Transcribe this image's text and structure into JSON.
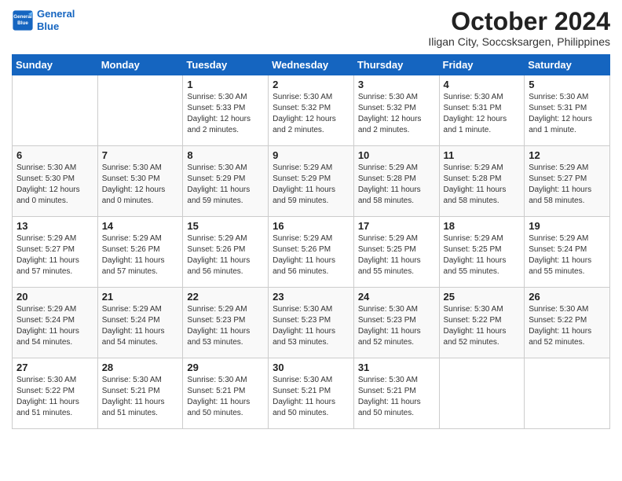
{
  "header": {
    "logo_line1": "General",
    "logo_line2": "Blue",
    "month": "October 2024",
    "location": "Iligan City, Soccsksargen, Philippines"
  },
  "weekdays": [
    "Sunday",
    "Monday",
    "Tuesday",
    "Wednesday",
    "Thursday",
    "Friday",
    "Saturday"
  ],
  "weeks": [
    [
      {
        "day": "",
        "detail": ""
      },
      {
        "day": "",
        "detail": ""
      },
      {
        "day": "1",
        "detail": "Sunrise: 5:30 AM\nSunset: 5:33 PM\nDaylight: 12 hours\nand 2 minutes."
      },
      {
        "day": "2",
        "detail": "Sunrise: 5:30 AM\nSunset: 5:32 PM\nDaylight: 12 hours\nand 2 minutes."
      },
      {
        "day": "3",
        "detail": "Sunrise: 5:30 AM\nSunset: 5:32 PM\nDaylight: 12 hours\nand 2 minutes."
      },
      {
        "day": "4",
        "detail": "Sunrise: 5:30 AM\nSunset: 5:31 PM\nDaylight: 12 hours\nand 1 minute."
      },
      {
        "day": "5",
        "detail": "Sunrise: 5:30 AM\nSunset: 5:31 PM\nDaylight: 12 hours\nand 1 minute."
      }
    ],
    [
      {
        "day": "6",
        "detail": "Sunrise: 5:30 AM\nSunset: 5:30 PM\nDaylight: 12 hours\nand 0 minutes."
      },
      {
        "day": "7",
        "detail": "Sunrise: 5:30 AM\nSunset: 5:30 PM\nDaylight: 12 hours\nand 0 minutes."
      },
      {
        "day": "8",
        "detail": "Sunrise: 5:30 AM\nSunset: 5:29 PM\nDaylight: 11 hours\nand 59 minutes."
      },
      {
        "day": "9",
        "detail": "Sunrise: 5:29 AM\nSunset: 5:29 PM\nDaylight: 11 hours\nand 59 minutes."
      },
      {
        "day": "10",
        "detail": "Sunrise: 5:29 AM\nSunset: 5:28 PM\nDaylight: 11 hours\nand 58 minutes."
      },
      {
        "day": "11",
        "detail": "Sunrise: 5:29 AM\nSunset: 5:28 PM\nDaylight: 11 hours\nand 58 minutes."
      },
      {
        "day": "12",
        "detail": "Sunrise: 5:29 AM\nSunset: 5:27 PM\nDaylight: 11 hours\nand 58 minutes."
      }
    ],
    [
      {
        "day": "13",
        "detail": "Sunrise: 5:29 AM\nSunset: 5:27 PM\nDaylight: 11 hours\nand 57 minutes."
      },
      {
        "day": "14",
        "detail": "Sunrise: 5:29 AM\nSunset: 5:26 PM\nDaylight: 11 hours\nand 57 minutes."
      },
      {
        "day": "15",
        "detail": "Sunrise: 5:29 AM\nSunset: 5:26 PM\nDaylight: 11 hours\nand 56 minutes."
      },
      {
        "day": "16",
        "detail": "Sunrise: 5:29 AM\nSunset: 5:26 PM\nDaylight: 11 hours\nand 56 minutes."
      },
      {
        "day": "17",
        "detail": "Sunrise: 5:29 AM\nSunset: 5:25 PM\nDaylight: 11 hours\nand 55 minutes."
      },
      {
        "day": "18",
        "detail": "Sunrise: 5:29 AM\nSunset: 5:25 PM\nDaylight: 11 hours\nand 55 minutes."
      },
      {
        "day": "19",
        "detail": "Sunrise: 5:29 AM\nSunset: 5:24 PM\nDaylight: 11 hours\nand 55 minutes."
      }
    ],
    [
      {
        "day": "20",
        "detail": "Sunrise: 5:29 AM\nSunset: 5:24 PM\nDaylight: 11 hours\nand 54 minutes."
      },
      {
        "day": "21",
        "detail": "Sunrise: 5:29 AM\nSunset: 5:24 PM\nDaylight: 11 hours\nand 54 minutes."
      },
      {
        "day": "22",
        "detail": "Sunrise: 5:29 AM\nSunset: 5:23 PM\nDaylight: 11 hours\nand 53 minutes."
      },
      {
        "day": "23",
        "detail": "Sunrise: 5:30 AM\nSunset: 5:23 PM\nDaylight: 11 hours\nand 53 minutes."
      },
      {
        "day": "24",
        "detail": "Sunrise: 5:30 AM\nSunset: 5:23 PM\nDaylight: 11 hours\nand 52 minutes."
      },
      {
        "day": "25",
        "detail": "Sunrise: 5:30 AM\nSunset: 5:22 PM\nDaylight: 11 hours\nand 52 minutes."
      },
      {
        "day": "26",
        "detail": "Sunrise: 5:30 AM\nSunset: 5:22 PM\nDaylight: 11 hours\nand 52 minutes."
      }
    ],
    [
      {
        "day": "27",
        "detail": "Sunrise: 5:30 AM\nSunset: 5:22 PM\nDaylight: 11 hours\nand 51 minutes."
      },
      {
        "day": "28",
        "detail": "Sunrise: 5:30 AM\nSunset: 5:21 PM\nDaylight: 11 hours\nand 51 minutes."
      },
      {
        "day": "29",
        "detail": "Sunrise: 5:30 AM\nSunset: 5:21 PM\nDaylight: 11 hours\nand 50 minutes."
      },
      {
        "day": "30",
        "detail": "Sunrise: 5:30 AM\nSunset: 5:21 PM\nDaylight: 11 hours\nand 50 minutes."
      },
      {
        "day": "31",
        "detail": "Sunrise: 5:30 AM\nSunset: 5:21 PM\nDaylight: 11 hours\nand 50 minutes."
      },
      {
        "day": "",
        "detail": ""
      },
      {
        "day": "",
        "detail": ""
      }
    ]
  ]
}
